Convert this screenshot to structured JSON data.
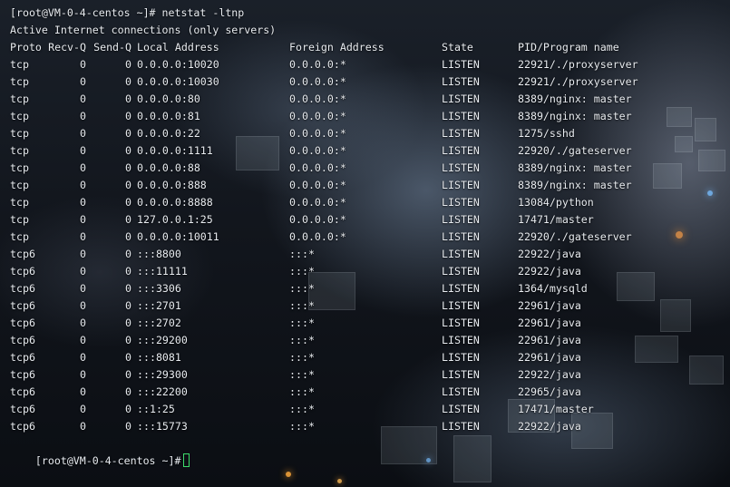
{
  "terminal": {
    "command_line": "[root@VM-0-4-centos ~]# netstat -ltnp",
    "info_line": "Active Internet connections (only servers)",
    "headers": {
      "proto": "Proto",
      "recvq": "Recv-Q",
      "sendq": "Send-Q",
      "local": "Local Address",
      "foreign": "Foreign Address",
      "state": "State",
      "prog": "PID/Program name"
    },
    "rows": [
      {
        "proto": "tcp",
        "recvq": "0",
        "sendq": "0",
        "local": "0.0.0.0:10020",
        "foreign": "0.0.0.0:*",
        "state": "LISTEN",
        "prog": "22921/./proxyserver"
      },
      {
        "proto": "tcp",
        "recvq": "0",
        "sendq": "0",
        "local": "0.0.0.0:10030",
        "foreign": "0.0.0.0:*",
        "state": "LISTEN",
        "prog": "22921/./proxyserver"
      },
      {
        "proto": "tcp",
        "recvq": "0",
        "sendq": "0",
        "local": "0.0.0.0:80",
        "foreign": "0.0.0.0:*",
        "state": "LISTEN",
        "prog": "8389/nginx: master"
      },
      {
        "proto": "tcp",
        "recvq": "0",
        "sendq": "0",
        "local": "0.0.0.0:81",
        "foreign": "0.0.0.0:*",
        "state": "LISTEN",
        "prog": "8389/nginx: master"
      },
      {
        "proto": "tcp",
        "recvq": "0",
        "sendq": "0",
        "local": "0.0.0.0:22",
        "foreign": "0.0.0.0:*",
        "state": "LISTEN",
        "prog": "1275/sshd"
      },
      {
        "proto": "tcp",
        "recvq": "0",
        "sendq": "0",
        "local": "0.0.0.0:1111",
        "foreign": "0.0.0.0:*",
        "state": "LISTEN",
        "prog": "22920/./gateserver"
      },
      {
        "proto": "tcp",
        "recvq": "0",
        "sendq": "0",
        "local": "0.0.0.0:88",
        "foreign": "0.0.0.0:*",
        "state": "LISTEN",
        "prog": "8389/nginx: master"
      },
      {
        "proto": "tcp",
        "recvq": "0",
        "sendq": "0",
        "local": "0.0.0.0:888",
        "foreign": "0.0.0.0:*",
        "state": "LISTEN",
        "prog": "8389/nginx: master"
      },
      {
        "proto": "tcp",
        "recvq": "0",
        "sendq": "0",
        "local": "0.0.0.0:8888",
        "foreign": "0.0.0.0:*",
        "state": "LISTEN",
        "prog": "13084/python"
      },
      {
        "proto": "tcp",
        "recvq": "0",
        "sendq": "0",
        "local": "127.0.0.1:25",
        "foreign": "0.0.0.0:*",
        "state": "LISTEN",
        "prog": "17471/master"
      },
      {
        "proto": "tcp",
        "recvq": "0",
        "sendq": "0",
        "local": "0.0.0.0:10011",
        "foreign": "0.0.0.0:*",
        "state": "LISTEN",
        "prog": "22920/./gateserver"
      },
      {
        "proto": "tcp6",
        "recvq": "0",
        "sendq": "0",
        "local": ":::8800",
        "foreign": ":::*",
        "state": "LISTEN",
        "prog": "22922/java"
      },
      {
        "proto": "tcp6",
        "recvq": "0",
        "sendq": "0",
        "local": ":::11111",
        "foreign": ":::*",
        "state": "LISTEN",
        "prog": "22922/java"
      },
      {
        "proto": "tcp6",
        "recvq": "0",
        "sendq": "0",
        "local": ":::3306",
        "foreign": ":::*",
        "state": "LISTEN",
        "prog": "1364/mysqld"
      },
      {
        "proto": "tcp6",
        "recvq": "0",
        "sendq": "0",
        "local": ":::2701",
        "foreign": ":::*",
        "state": "LISTEN",
        "prog": "22961/java"
      },
      {
        "proto": "tcp6",
        "recvq": "0",
        "sendq": "0",
        "local": ":::2702",
        "foreign": ":::*",
        "state": "LISTEN",
        "prog": "22961/java"
      },
      {
        "proto": "tcp6",
        "recvq": "0",
        "sendq": "0",
        "local": ":::29200",
        "foreign": ":::*",
        "state": "LISTEN",
        "prog": "22961/java"
      },
      {
        "proto": "tcp6",
        "recvq": "0",
        "sendq": "0",
        "local": ":::8081",
        "foreign": ":::*",
        "state": "LISTEN",
        "prog": "22961/java"
      },
      {
        "proto": "tcp6",
        "recvq": "0",
        "sendq": "0",
        "local": ":::29300",
        "foreign": ":::*",
        "state": "LISTEN",
        "prog": "22922/java"
      },
      {
        "proto": "tcp6",
        "recvq": "0",
        "sendq": "0",
        "local": ":::22200",
        "foreign": ":::*",
        "state": "LISTEN",
        "prog": "22965/java"
      },
      {
        "proto": "tcp6",
        "recvq": "0",
        "sendq": "0",
        "local": "::1:25",
        "foreign": ":::*",
        "state": "LISTEN",
        "prog": "17471/master"
      },
      {
        "proto": "tcp6",
        "recvq": "0",
        "sendq": "0",
        "local": ":::15773",
        "foreign": ":::*",
        "state": "LISTEN",
        "prog": "22922/java"
      }
    ],
    "prompt": "[root@VM-0-4-centos ~]#",
    "colors": {
      "text": "#e9edf2",
      "cursor": "#3ddc6b"
    }
  }
}
